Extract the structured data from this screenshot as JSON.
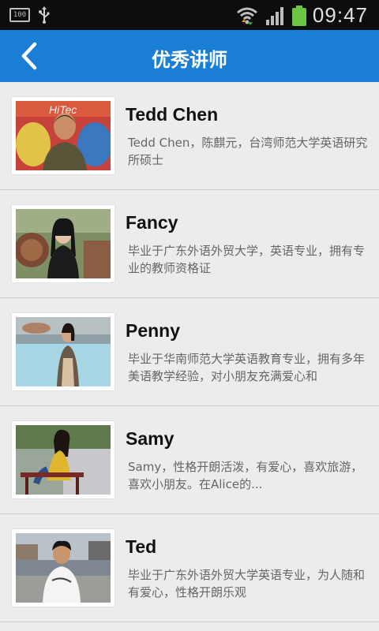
{
  "status_bar": {
    "time": "09:47",
    "battery_small_label": "100",
    "icons": [
      "battery-100-icon",
      "usb-icon",
      "wifi-icon",
      "signal-icon",
      "battery-icon"
    ]
  },
  "header": {
    "title": "优秀讲师",
    "back_icon": "chevron-left-icon",
    "color": "#1a7fd4"
  },
  "teachers": [
    {
      "name": "Tedd Chen",
      "desc": "Tedd Chen，陈麒元，台湾师范大学英语研究所硕士"
    },
    {
      "name": "Fancy",
      "desc": "毕业于广东外语外贸大学，英语专业，拥有专业的教师资格证"
    },
    {
      "name": "Penny",
      "desc": "毕业于华南师范大学英语教育专业，拥有多年美语教学经验，对小朋友充满爱心和"
    },
    {
      "name": "Samy",
      "desc": "Samy，性格开朗活泼，有爱心，喜欢旅游，喜欢小朋友。在Alice的..."
    },
    {
      "name": "Ted",
      "desc": "毕业于广东外语外贸大学英语专业，为人随和有爱心，性格开朗乐观"
    }
  ]
}
